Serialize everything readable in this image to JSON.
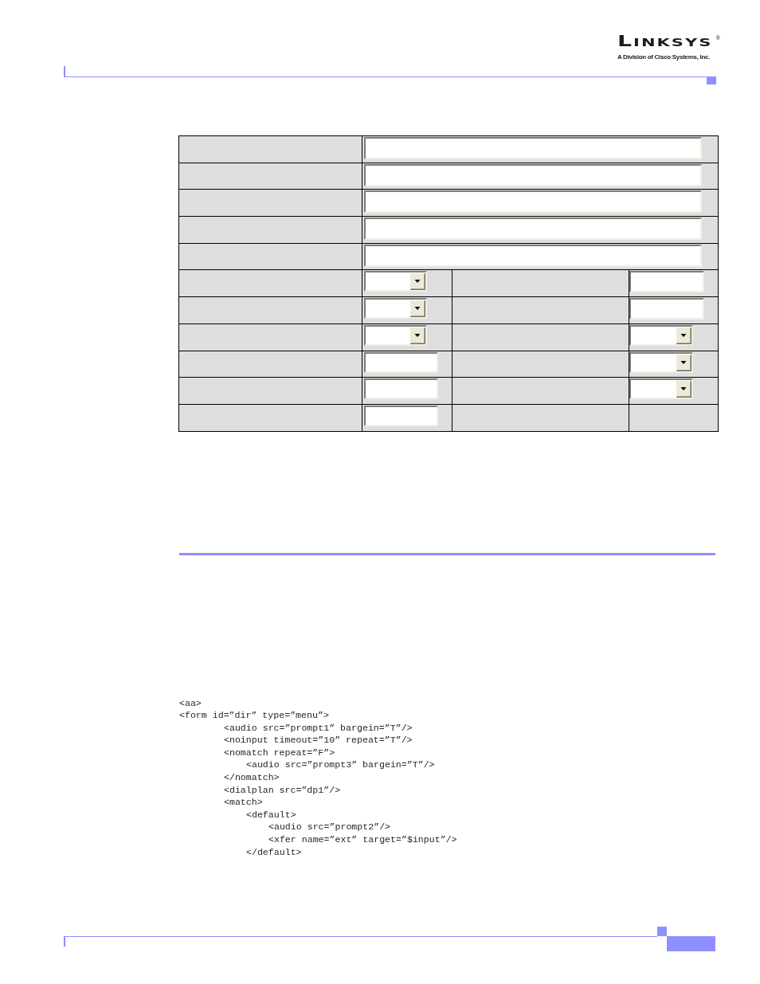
{
  "logo": {
    "wordmark": "LINKSYS",
    "registered_mark": "®",
    "tagline": "A Division of Cisco Systems, Inc."
  },
  "settings_table": {
    "rows": [
      {
        "kind": "single",
        "field": {
          "kind": "text"
        }
      },
      {
        "kind": "single",
        "field": {
          "kind": "text"
        }
      },
      {
        "kind": "single",
        "field": {
          "kind": "text"
        }
      },
      {
        "kind": "single",
        "field": {
          "kind": "text"
        }
      },
      {
        "kind": "single",
        "field": {
          "kind": "text"
        }
      },
      {
        "kind": "double",
        "fields": [
          {
            "kind": "select"
          },
          {
            "kind": "text"
          }
        ]
      },
      {
        "kind": "double",
        "fields": [
          {
            "kind": "select"
          },
          {
            "kind": "text"
          }
        ]
      },
      {
        "kind": "double",
        "fields": [
          {
            "kind": "select"
          },
          {
            "kind": "select"
          }
        ]
      },
      {
        "kind": "double",
        "fields": [
          {
            "kind": "text"
          },
          {
            "kind": "select"
          }
        ]
      },
      {
        "kind": "double",
        "fields": [
          {
            "kind": "text"
          },
          {
            "kind": "select"
          }
        ]
      },
      {
        "kind": "double",
        "fields": [
          {
            "kind": "text"
          }
        ]
      }
    ]
  },
  "code_listing": {
    "lines": [
      {
        "text": "<aa>"
      },
      {
        "text": "<form id=”dir” type=”menu”>",
        "children": [
          {
            "text": "<audio src=”prompt1” bargein=”T”/>"
          },
          {
            "text": "<noinput timeout=”10” repeat=”T”/>"
          },
          {
            "text": "<nomatch repeat=”F”>",
            "children": [
              {
                "text": "<audio src=”prompt3” bargein=”T”/>"
              }
            ]
          },
          {
            "text": "</nomatch>"
          },
          {
            "text": "<dialplan src=”dp1”/>"
          },
          {
            "text": "<match>",
            "children": [
              {
                "text": "<default>",
                "children": [
                  {
                    "text": "<audio src=”prompt2”/>"
                  },
                  {
                    "text": "<xfer name=”ext” target=”$input”/>"
                  }
                ]
              },
              {
                "text": "</default>"
              }
            ]
          }
        ]
      }
    ]
  }
}
